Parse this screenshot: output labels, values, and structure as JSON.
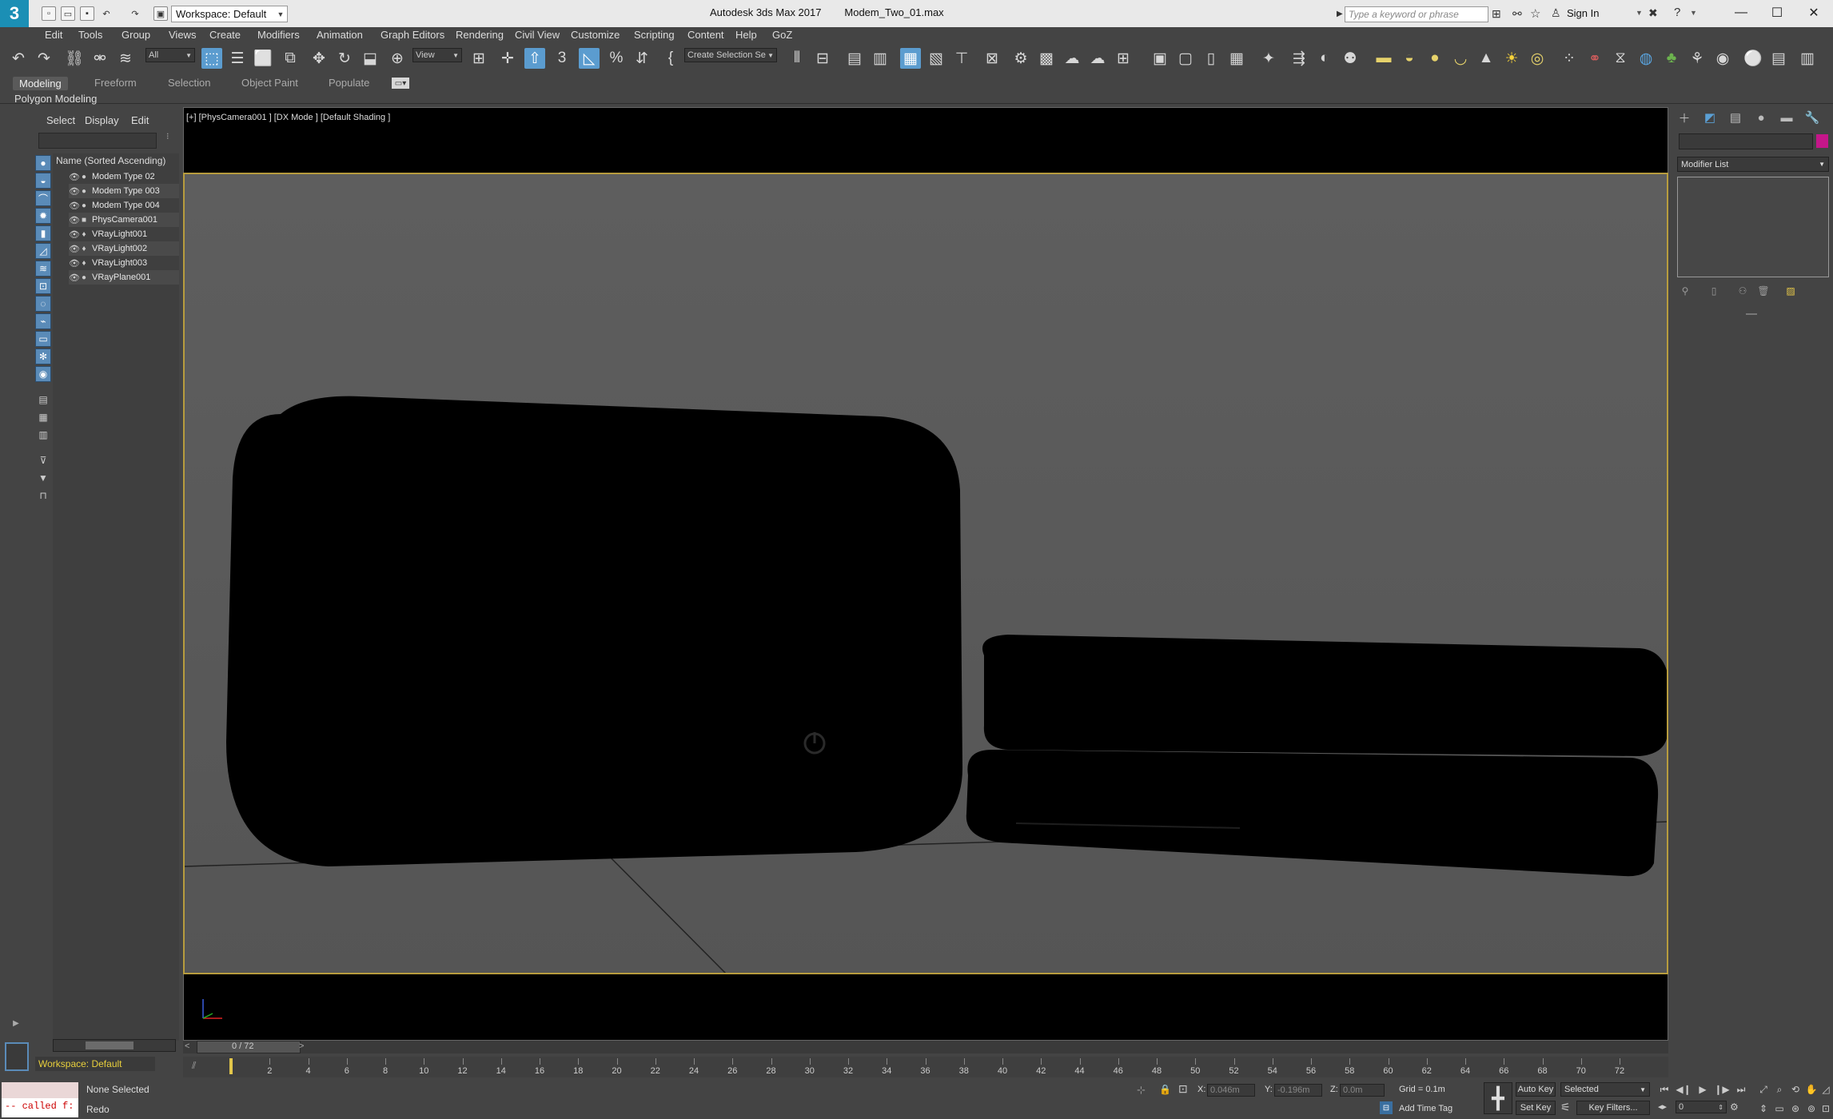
{
  "window": {
    "app_title": "Autodesk 3ds Max 2017",
    "file_name": "Modem_Two_01.max",
    "workspace": "Workspace: Default",
    "search_placeholder": "Type a keyword or phrase",
    "sign_in": "Sign In"
  },
  "menu": [
    "Edit",
    "Tools",
    "Group",
    "Views",
    "Create",
    "Modifiers",
    "Animation",
    "Graph Editors",
    "Rendering",
    "Civil View",
    "Customize",
    "Scripting",
    "Content",
    "Help",
    "GoZ"
  ],
  "toolbar": {
    "selection_filter": "All",
    "ref_coord": "View",
    "selection_set": "Create Selection Se"
  },
  "ribbon": {
    "tabs": [
      "Modeling",
      "Freeform",
      "Selection",
      "Object Paint",
      "Populate"
    ],
    "active_tab": "Modeling",
    "sub_label": "Polygon Modeling"
  },
  "scene_explorer": {
    "tabs": [
      "Select",
      "Display",
      "Edit"
    ],
    "column_header": "Name (Sorted Ascending)",
    "items": [
      {
        "name": "Modem Type 02",
        "type": "geometry"
      },
      {
        "name": "Modem Type 003",
        "type": "geometry"
      },
      {
        "name": "Modem Type 004",
        "type": "geometry"
      },
      {
        "name": "PhysCamera001",
        "type": "camera"
      },
      {
        "name": "VRayLight001",
        "type": "light"
      },
      {
        "name": "VRayLight002",
        "type": "light"
      },
      {
        "name": "VRayLight003",
        "type": "light"
      },
      {
        "name": "VRayPlane001",
        "type": "geometry"
      }
    ],
    "workspace_label": "Workspace: Default"
  },
  "viewport": {
    "label": "[+] [PhysCamera001 ] [DX Mode ] [Default Shading ]"
  },
  "command_panel": {
    "modifier_list": "Modifier List",
    "color_swatch": "#c5168a"
  },
  "timeline": {
    "frame_counter": "0 / 72",
    "ticks": [
      "0",
      "2",
      "4",
      "6",
      "8",
      "10",
      "12",
      "14",
      "16",
      "18",
      "20",
      "22",
      "24",
      "26",
      "28",
      "30",
      "32",
      "34",
      "36",
      "38",
      "40",
      "42",
      "44",
      "46",
      "48",
      "50",
      "52",
      "54",
      "56",
      "58",
      "60",
      "62",
      "64",
      "66",
      "68",
      "70",
      "72"
    ]
  },
  "status": {
    "maxscript_output": "-- called f:",
    "selection_status": "None Selected",
    "prompt": "Redo",
    "x_label": "X:",
    "x_value": "0.046m",
    "y_label": "Y:",
    "y_value": "-0.196m",
    "z_label": "Z:",
    "z_value": "0.0m",
    "grid": "Grid = 0.1m",
    "add_time_tag": "Add Time Tag",
    "auto_key": "Auto Key",
    "set_key": "Set Key",
    "key_mode": "Selected",
    "key_filters": "Key Filters...",
    "current_frame": "0"
  }
}
